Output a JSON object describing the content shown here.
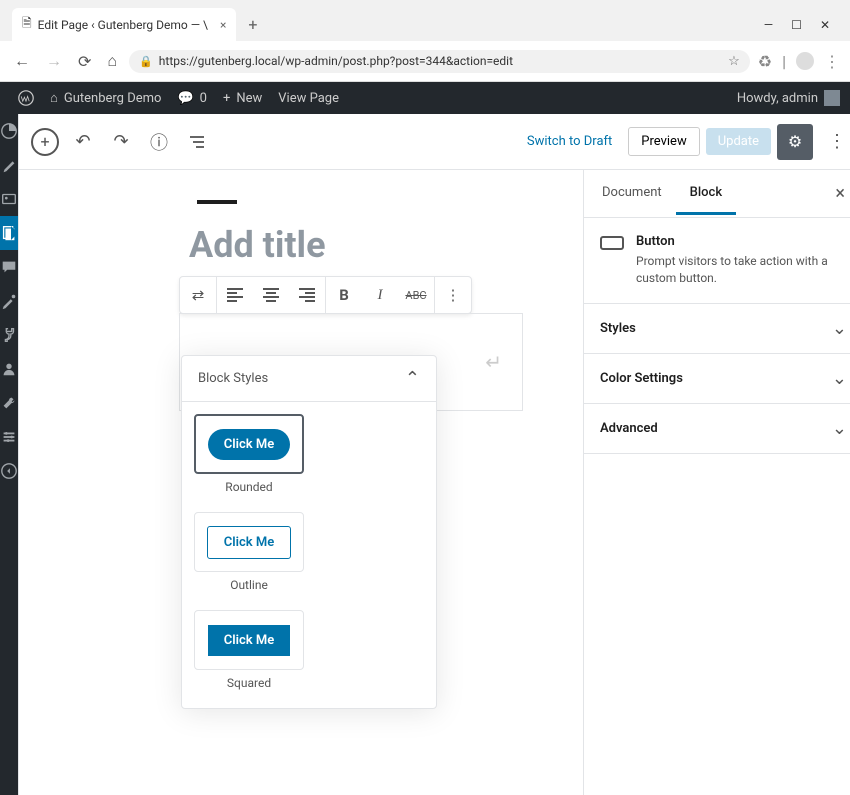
{
  "browser": {
    "tab_title": "Edit Page ‹ Gutenberg Demo — \\",
    "url": "https://gutenberg.local/wp-admin/post.php?post=344&action=edit"
  },
  "admin_bar": {
    "site_name": "Gutenberg Demo",
    "comments": "0",
    "new": "New",
    "view": "View Page",
    "howdy": "Howdy, admin"
  },
  "editor_top": {
    "switch_draft": "Switch to Draft",
    "preview": "Preview",
    "update": "Update"
  },
  "canvas": {
    "title_placeholder": "Add title"
  },
  "styles_panel": {
    "title": "Block Styles",
    "styles": [
      {
        "label": "Rounded",
        "kind": "rounded",
        "demo": "Click Me",
        "selected": true
      },
      {
        "label": "Outline",
        "kind": "outline",
        "demo": "Click Me",
        "selected": false
      },
      {
        "label": "Squared",
        "kind": "squared",
        "demo": "Click Me",
        "selected": false
      }
    ]
  },
  "sidebar": {
    "tab_document": "Document",
    "tab_block": "Block",
    "block_name": "Button",
    "block_desc": "Prompt visitors to take action with a custom button.",
    "sections": [
      "Styles",
      "Color Settings",
      "Advanced"
    ]
  }
}
